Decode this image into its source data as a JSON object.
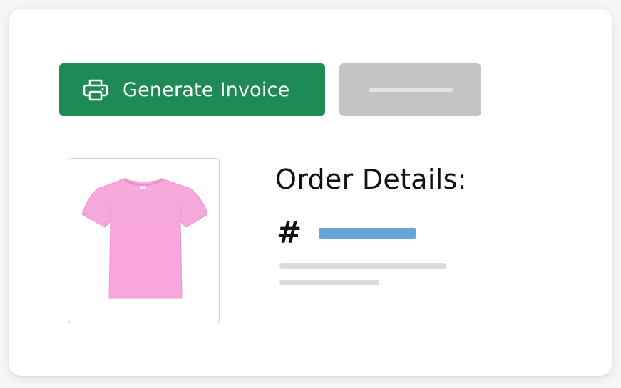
{
  "actions": {
    "generate_invoice_label": "Generate Invoice",
    "generate_invoice_icon": "printer-icon",
    "secondary_button_icon": "placeholder-bar"
  },
  "product": {
    "image_icon": "tshirt-icon",
    "shirt_color": "#f8a8d8"
  },
  "order": {
    "title": "Order Details:",
    "number_prefix": "#"
  },
  "colors": {
    "primary": "#1e8a55",
    "secondary_button": "#c4c4c4",
    "order_number_placeholder": "#69a3d8",
    "text_placeholder": "#dcdcdc"
  }
}
